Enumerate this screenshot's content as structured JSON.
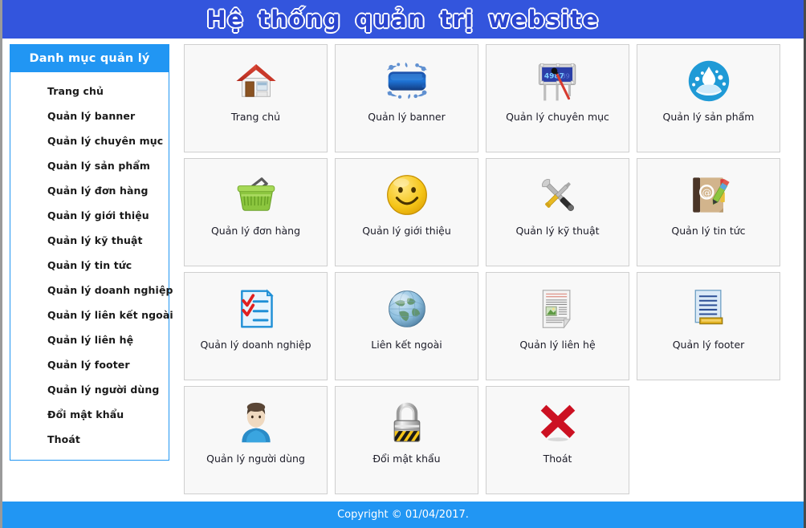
{
  "header": {
    "title": "Hệ thống quản trị website",
    "bg": "#3355dd",
    "text_color": "#2a44cf",
    "outline_color": "#ffffff"
  },
  "sidebar": {
    "title": "Danh mục quản lý",
    "accent": "#2196f3",
    "items": [
      {
        "label": "Trang chủ"
      },
      {
        "label": "Quản lý banner"
      },
      {
        "label": "Quản lý chuyên mục"
      },
      {
        "label": "Quản lý sản phẩm"
      },
      {
        "label": "Quản lý đơn hàng"
      },
      {
        "label": "Quản lý giới thiệu"
      },
      {
        "label": "Quản lý kỹ thuật"
      },
      {
        "label": "Quản lý tin tức"
      },
      {
        "label": "Quản lý doanh nghiệp"
      },
      {
        "label": "Quản lý liên kết ngoài"
      },
      {
        "label": "Quản lý liên hệ"
      },
      {
        "label": "Quản lý footer"
      },
      {
        "label": "Quản lý người dùng"
      },
      {
        "label": "Đổi mật khẩu"
      },
      {
        "label": "Thoát"
      }
    ]
  },
  "main": {
    "cards": [
      {
        "label": "Trang chủ",
        "icon": "house-icon"
      },
      {
        "label": "Quản lý banner",
        "icon": "banner-icon"
      },
      {
        "label": "Quản lý chuyên mục",
        "icon": "billboard-icon"
      },
      {
        "label": "Quản lý sản phẩm",
        "icon": "water-drop-icon"
      },
      {
        "label": "Quản lý đơn hàng",
        "icon": "shopping-basket-icon"
      },
      {
        "label": "Quản lý giới thiệu",
        "icon": "smiley-face-icon"
      },
      {
        "label": "Quản lý kỹ thuật",
        "icon": "tools-icon"
      },
      {
        "label": "Quản lý tin tức",
        "icon": "address-book-icon"
      },
      {
        "label": "Quản lý doanh nghiệp",
        "icon": "checklist-icon"
      },
      {
        "label": "Liên kết ngoài",
        "icon": "globe-icon"
      },
      {
        "label": "Quản lý liên hệ",
        "icon": "document-page-icon"
      },
      {
        "label": "Quản lý footer",
        "icon": "footer-document-icon"
      },
      {
        "label": "Quản lý người dùng",
        "icon": "user-avatar-icon"
      },
      {
        "label": "Đổi mật khẩu",
        "icon": "padlock-icon"
      },
      {
        "label": "Thoát",
        "icon": "red-x-icon"
      }
    ]
  },
  "footer": {
    "copyright": "Copyright © 01/04/2017.",
    "bg": "#2196f3"
  }
}
